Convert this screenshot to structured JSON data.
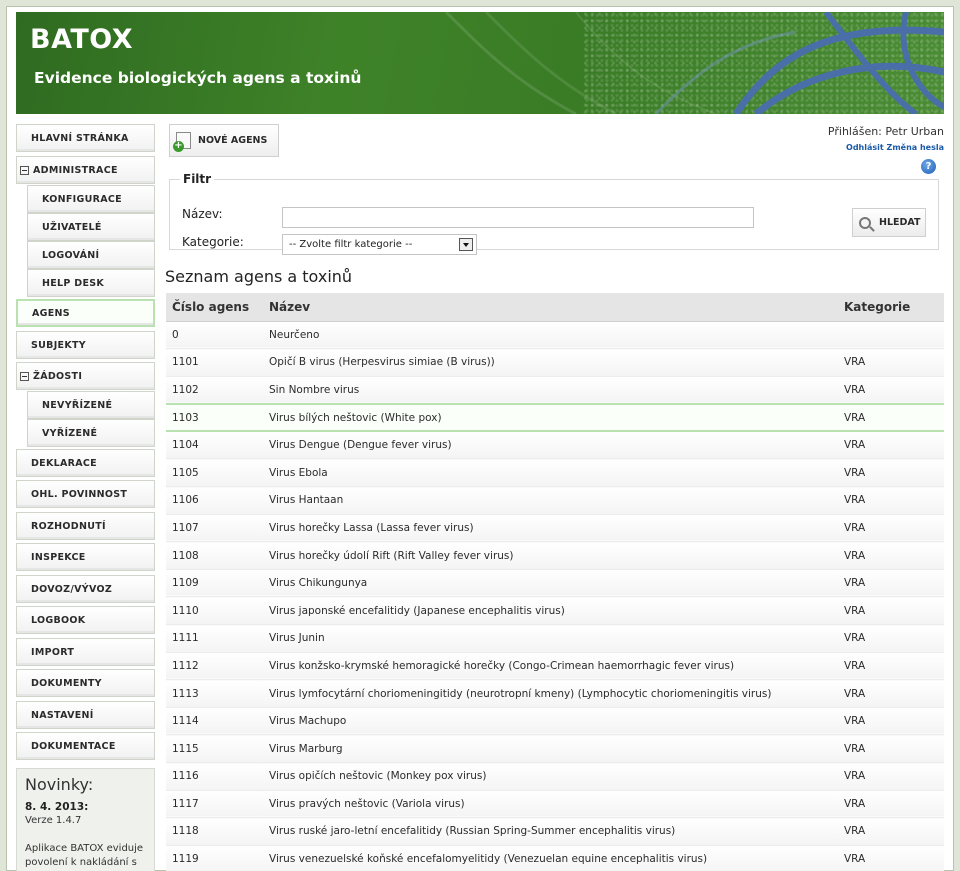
{
  "header": {
    "title": "BATOX",
    "subtitle": "Evidence biologických agens a toxinů"
  },
  "sidebar": {
    "items": [
      {
        "label": "HLAVNÍ STRÁNKA"
      },
      {
        "label": "ADMINISTRACE"
      },
      {
        "label": "KONFIGURACE"
      },
      {
        "label": "UŽIVATELÉ"
      },
      {
        "label": "LOGOVÁNÍ"
      },
      {
        "label": "HELP DESK"
      },
      {
        "label": "AGENS"
      },
      {
        "label": "SUBJEKTY"
      },
      {
        "label": "ŽÁDOSTI"
      },
      {
        "label": "NEVYŘÍZENÉ"
      },
      {
        "label": "VYŘÍZENÉ"
      },
      {
        "label": "DEKLARACE"
      },
      {
        "label": "OHL. POVINNOST"
      },
      {
        "label": "ROZHODNUTÍ"
      },
      {
        "label": "INSPEKCE"
      },
      {
        "label": "DOVOZ/VÝVOZ"
      },
      {
        "label": "LOGBOOK"
      },
      {
        "label": "IMPORT"
      },
      {
        "label": "DOKUMENTY"
      },
      {
        "label": "NASTAVENÍ"
      },
      {
        "label": "DOKUMENTACE"
      }
    ],
    "active": "AGENS"
  },
  "news": {
    "title": "Novinky:",
    "date": "8. 4. 2013:",
    "version": "Verze 1.4.7",
    "text": "Aplikace BATOX eviduje povolení k nakládání s"
  },
  "toolbar": {
    "new_agent_label": "NOVÉ AGENS"
  },
  "user": {
    "logged_in": "Přihlášen: Petr Urban",
    "logout": "Odhlásit",
    "change_password": "Změna hesla",
    "help": "?"
  },
  "filter": {
    "legend": "Filtr",
    "name_label": "Název:",
    "name_value": "",
    "category_label": "Kategorie:",
    "category_value": "-- Zvolte filtr kategorie --",
    "search_label": "HLEDAT"
  },
  "list": {
    "title": "Seznam agens a toxinů",
    "columns": [
      "Číslo agens",
      "Název",
      "Kategorie"
    ],
    "rows": [
      [
        "0",
        "Neurčeno",
        ""
      ],
      [
        "1101",
        "Opičí B virus (Herpesvirus simiae (B virus))",
        "VRA"
      ],
      [
        "1102",
        "Sin Nombre virus",
        "VRA"
      ],
      [
        "1103",
        "Virus bílých neštovic (White pox)",
        "VRA"
      ],
      [
        "1104",
        "Virus Dengue (Dengue fever virus)",
        "VRA"
      ],
      [
        "1105",
        "Virus Ebola",
        "VRA"
      ],
      [
        "1106",
        "Virus Hantaan",
        "VRA"
      ],
      [
        "1107",
        "Virus horečky Lassa (Lassa fever virus)",
        "VRA"
      ],
      [
        "1108",
        "Virus horečky údolí Rift (Rift Valley fever virus)",
        "VRA"
      ],
      [
        "1109",
        "Virus Chikungunya",
        "VRA"
      ],
      [
        "1110",
        "Virus japonské encefalitidy (Japanese encephalitis virus)",
        "VRA"
      ],
      [
        "1111",
        "Virus Junin",
        "VRA"
      ],
      [
        "1112",
        "Virus konžsko-krymské hemoragické horečky (Congo-Crimean haemorrhagic fever virus)",
        "VRA"
      ],
      [
        "1113",
        "Virus lymfocytární choriomeningitidy (neurotropní kmeny) (Lymphocytic choriomeningitis virus)",
        "VRA"
      ],
      [
        "1114",
        "Virus Machupo",
        "VRA"
      ],
      [
        "1115",
        "Virus Marburg",
        "VRA"
      ],
      [
        "1116",
        "Virus opičích neštovic (Monkey pox virus)",
        "VRA"
      ],
      [
        "1117",
        "Virus pravých neštovic (Variola virus)",
        "VRA"
      ],
      [
        "1118",
        "Virus ruské jaro-letní encefalitidy (Russian Spring-Summer encephalitis virus)",
        "VRA"
      ],
      [
        "1119",
        "Virus venezuelské koňské encefalomyelitidy (Venezuelan equine encephalitis virus)",
        "VRA"
      ]
    ],
    "highlighted_row": "1103"
  }
}
